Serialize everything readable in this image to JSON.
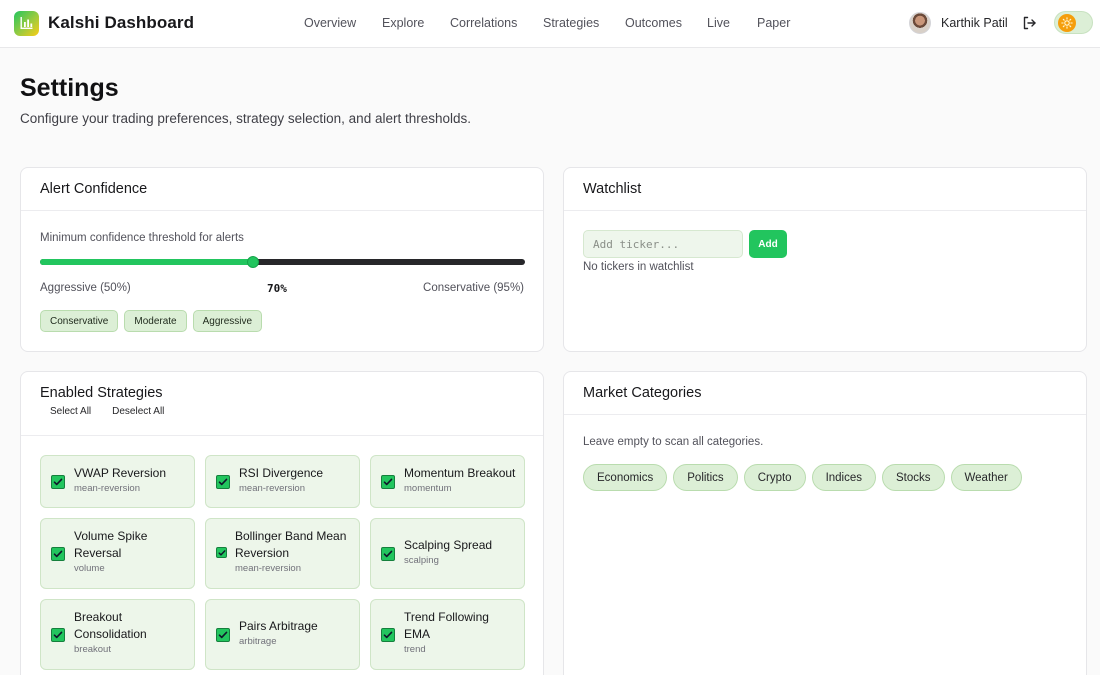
{
  "app": {
    "title": "Kalshi Dashboard"
  },
  "nav": {
    "items": [
      "Overview",
      "Explore",
      "Correlations",
      "Strategies",
      "Outcomes",
      "Live",
      "Paper"
    ]
  },
  "user": {
    "name": "Karthik Patil"
  },
  "page": {
    "title": "Settings",
    "subtitle": "Configure your trading preferences, strategy selection, and alert thresholds."
  },
  "alert_confidence": {
    "title": "Alert Confidence",
    "label": "Minimum confidence threshold for alerts",
    "value_label": "70%",
    "value_fraction": 0.44,
    "min_label": "Aggressive (50%)",
    "max_label": "Conservative (95%)",
    "presets": [
      "Conservative",
      "Moderate",
      "Aggressive"
    ]
  },
  "watchlist": {
    "title": "Watchlist",
    "input_placeholder": "Add ticker...",
    "add_label": "Add",
    "empty_text": "No tickers in watchlist"
  },
  "strategies": {
    "title": "Enabled Strategies",
    "select_all": "Select All",
    "deselect_all": "Deselect All",
    "items": [
      {
        "name": "VWAP Reversion",
        "tag": "mean-reversion",
        "checked": true
      },
      {
        "name": "RSI Divergence",
        "tag": "mean-reversion",
        "checked": true
      },
      {
        "name": "Momentum Breakout",
        "tag": "momentum",
        "checked": true
      },
      {
        "name": "Volume Spike Reversal",
        "tag": "volume",
        "checked": true
      },
      {
        "name": "Bollinger Band Mean Reversion",
        "tag": "mean-reversion",
        "checked": true
      },
      {
        "name": "Scalping Spread",
        "tag": "scalping",
        "checked": true
      },
      {
        "name": "Breakout Consolidation",
        "tag": "breakout",
        "checked": true
      },
      {
        "name": "Pairs Arbitrage",
        "tag": "arbitrage",
        "checked": true
      },
      {
        "name": "Trend Following EMA",
        "tag": "trend",
        "checked": true
      }
    ]
  },
  "market_categories": {
    "title": "Market Categories",
    "note": "Leave empty to scan all categories.",
    "chips": [
      "Economics",
      "Politics",
      "Crypto",
      "Indices",
      "Stocks",
      "Weather"
    ]
  },
  "colors": {
    "accent": "#22c55e",
    "chip_bg": "#dcefd6",
    "card_tint": "#edf6ea"
  },
  "icons": [
    "bar-chart-icon",
    "logout-icon",
    "sun-icon",
    "check-icon"
  ]
}
